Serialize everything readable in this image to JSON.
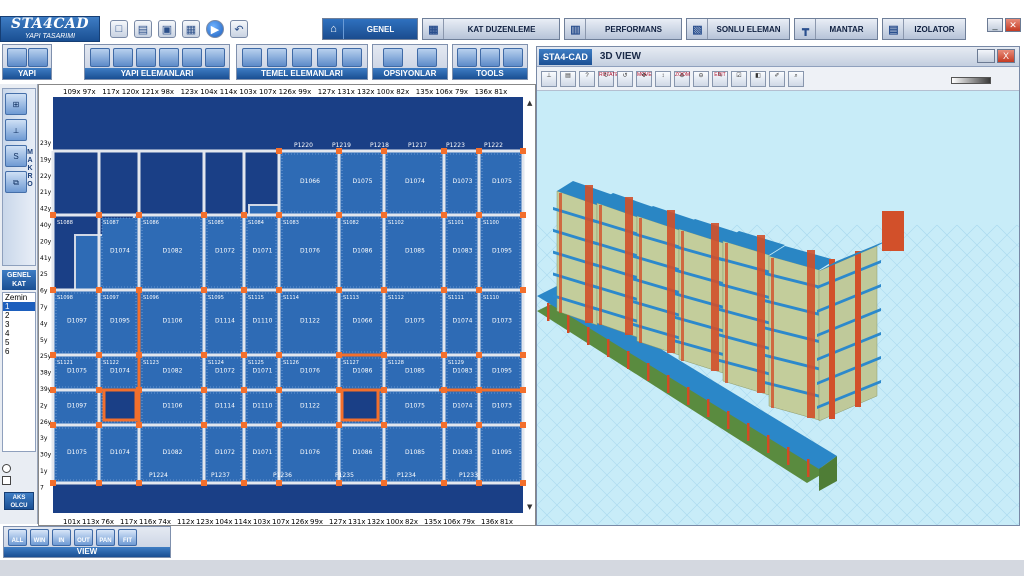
{
  "brand": {
    "name": "STA4CAD",
    "subtitle": "YAPI TASARIMI"
  },
  "tabs": [
    {
      "label": "GENEL",
      "icon": "home-icon",
      "active": true
    },
    {
      "label": "KAT DUZENLEME",
      "icon": "floor-edit-icon",
      "active": false
    },
    {
      "label": "PERFORMANS",
      "icon": "performance-chart-icon",
      "active": false
    },
    {
      "label": "SONLU ELEMAN",
      "icon": "finite-element-icon",
      "active": false
    },
    {
      "label": "MANTAR",
      "icon": "mushroom-slab-icon",
      "active": false
    },
    {
      "label": "IZOLATOR",
      "icon": "isolator-icon",
      "active": false
    }
  ],
  "ribbon_groups": [
    {
      "label": "YAPI",
      "icon_count": 2
    },
    {
      "label": "YAPI ELEMANLARI",
      "icon_count": 7
    },
    {
      "label": "TEMEL ELEMANLARI",
      "icon_count": 6
    },
    {
      "label": "OPSIYONLAR",
      "icon_count": 2
    },
    {
      "label": "TOOLS",
      "icon_count": 3
    }
  ],
  "left_panel": {
    "makro_label": "MAKRO",
    "floor_header": "GENEL KAT",
    "floors": [
      "Zemin",
      "1",
      "2",
      "3",
      "4",
      "5",
      "6"
    ],
    "selected_floor": "1",
    "aks_label": "AKS OLCU"
  },
  "drawing": {
    "top_axis_labels": [
      "109x",
      "97x",
      "117x",
      "120x",
      "121x",
      "98x",
      "123x",
      "104x",
      "114x",
      "103x",
      "107x",
      "126x",
      "99x",
      "127x",
      "131x",
      "132x",
      "100x",
      "82x",
      "135x",
      "106x",
      "79x",
      "136x",
      "81x"
    ],
    "bottom_axis_labels": [
      "101x",
      "113x",
      "76x",
      "117x",
      "116x",
      "74x",
      "112x",
      "123x",
      "104x",
      "114x",
      "103x",
      "107x",
      "126x",
      "99x",
      "127x",
      "131x",
      "132x",
      "100x",
      "82x",
      "135x",
      "106x",
      "79x",
      "136x",
      "81x"
    ],
    "left_axis_labels": [
      "23y",
      "19y",
      "22y",
      "21y",
      "42y",
      "40y",
      "20y",
      "41y",
      "25",
      "6y",
      "7y",
      "4y",
      "5y",
      "25y",
      "38y",
      "39y",
      "2y",
      "26y",
      "3y",
      "30y",
      "1y",
      "7"
    ],
    "beam_labels": [
      "P1220",
      "P1219",
      "P1218",
      "P1217",
      "P1223",
      "P1222",
      "P1224",
      "P1237",
      "P1236",
      "P1235",
      "P1234",
      "P1233"
    ],
    "slab_labels": [
      "D1066",
      "D1075",
      "D1074",
      "D1073",
      "D1075",
      "D1074",
      "D1082",
      "D1072",
      "D1071",
      "D1076",
      "D1086",
      "D1085",
      "D1083",
      "D1095",
      "D1097",
      "D1095",
      "D1106",
      "D1114",
      "D1110",
      "D1122"
    ],
    "column_labels": [
      "S1076",
      "S1077",
      "S1075",
      "S1074",
      "S1073",
      "S1089",
      "S1088",
      "S1087",
      "S1086",
      "S1085",
      "S1084",
      "S1083",
      "S1082",
      "S1102",
      "S1101",
      "S1100",
      "S1099",
      "S1098",
      "S1097",
      "S1096",
      "S1095",
      "S1115",
      "S1114",
      "S1113",
      "S1112",
      "S1111",
      "S1110",
      "S1109",
      "S1121",
      "S1122",
      "S1123",
      "S1124",
      "S1125",
      "S1126",
      "S1127",
      "S1128",
      "S1129"
    ]
  },
  "view_toolbar": {
    "label": "VIEW",
    "buttons": [
      "ALL",
      "WIN",
      "IN",
      "OUT",
      "PAN",
      "FIT"
    ]
  },
  "view3d": {
    "logo": "STA4-CAD",
    "title": "3D VIEW",
    "tool_labels": [
      "ROTATE",
      "MOVE",
      "ZOOM",
      "EDIT"
    ],
    "close_label": "X"
  },
  "colors": {
    "plan_background": "#1a3f86",
    "slab_fill": "#2e6bb5",
    "beam": "#f36f2c",
    "sky": "#c8ecf8",
    "accent": "#1d5fbd"
  }
}
